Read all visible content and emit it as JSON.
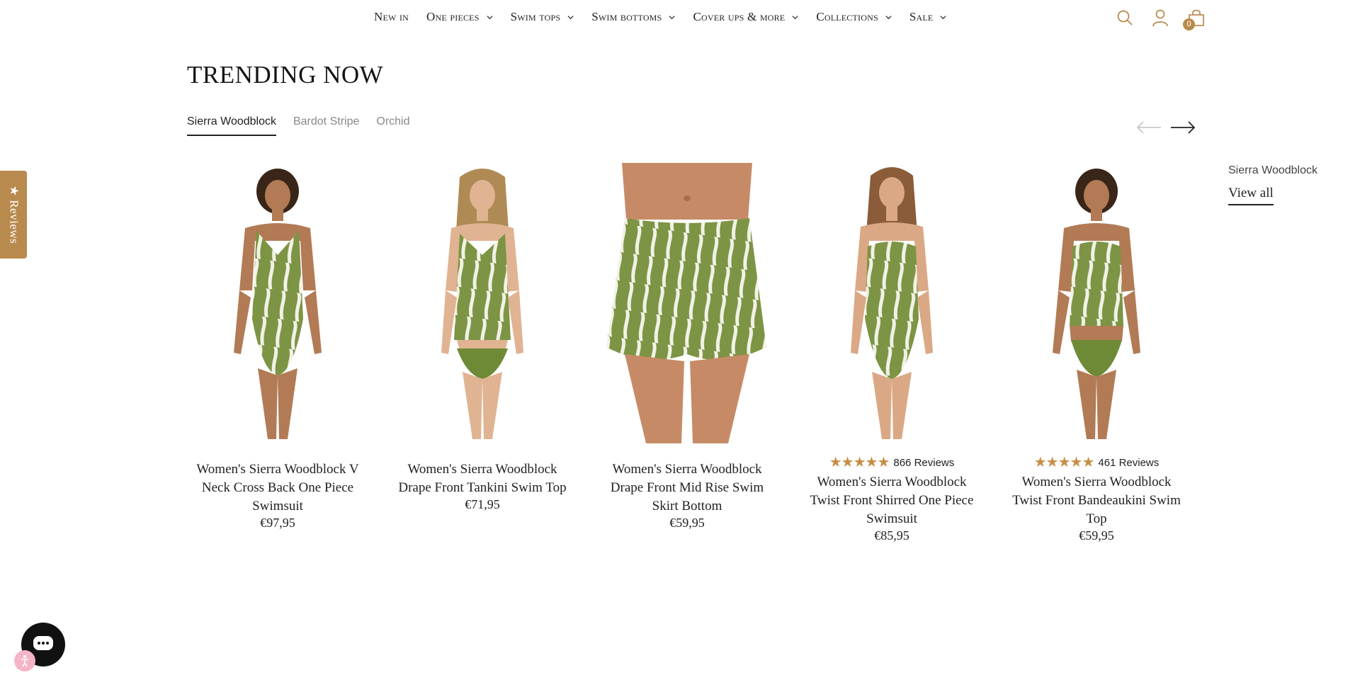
{
  "nav": {
    "items": [
      {
        "label": "New in",
        "has_dropdown": false
      },
      {
        "label": "One pieces",
        "has_dropdown": true
      },
      {
        "label": "Swim tops",
        "has_dropdown": true
      },
      {
        "label": "Swim bottoms",
        "has_dropdown": true
      },
      {
        "label": "Cover ups & more",
        "has_dropdown": true
      },
      {
        "label": "Collections",
        "has_dropdown": true
      },
      {
        "label": "Sale",
        "has_dropdown": true
      }
    ],
    "cart_count": "0",
    "icon_color": "#b98a4d"
  },
  "section": {
    "title": "TRENDING NOW",
    "tabs": [
      {
        "label": "Sierra Woodblock",
        "active": true
      },
      {
        "label": "Bardot Stripe",
        "active": false
      },
      {
        "label": "Orchid",
        "active": false
      }
    ],
    "collection_name": "Sierra Woodblock",
    "view_all_label": "View all"
  },
  "products": [
    {
      "title": "Women's Sierra Woodblock V Neck Cross Back One Piece Swimsuit",
      "price": "€97,95",
      "rating": null,
      "reviews": null,
      "image": "model-one-piece"
    },
    {
      "title": "Women's Sierra Woodblock Drape Front Tankini Swim Top",
      "price": "€71,95",
      "rating": null,
      "reviews": null,
      "image": "model-tankini"
    },
    {
      "title": "Women's Sierra Woodblock Drape Front Mid Rise Swim Skirt Bottom",
      "price": "€59,95",
      "rating": null,
      "reviews": null,
      "image": "swim-skirt"
    },
    {
      "title": "Women's Sierra Woodblock Twist Front Shirred One Piece Swimsuit",
      "price": "€85,95",
      "rating": 5,
      "reviews": "866 Reviews",
      "image": "model-bandeau-one-piece"
    },
    {
      "title": "Women's Sierra Woodblock Twist Front Bandeaukini Swim Top",
      "price": "€59,95",
      "rating": 4.5,
      "reviews": "461 Reviews",
      "image": "model-bandeaukini"
    }
  ],
  "widgets": {
    "reviews_tab_label": "★ Reviews",
    "accent_color": "#b98a4d",
    "swatch_green": "#7c9444"
  }
}
